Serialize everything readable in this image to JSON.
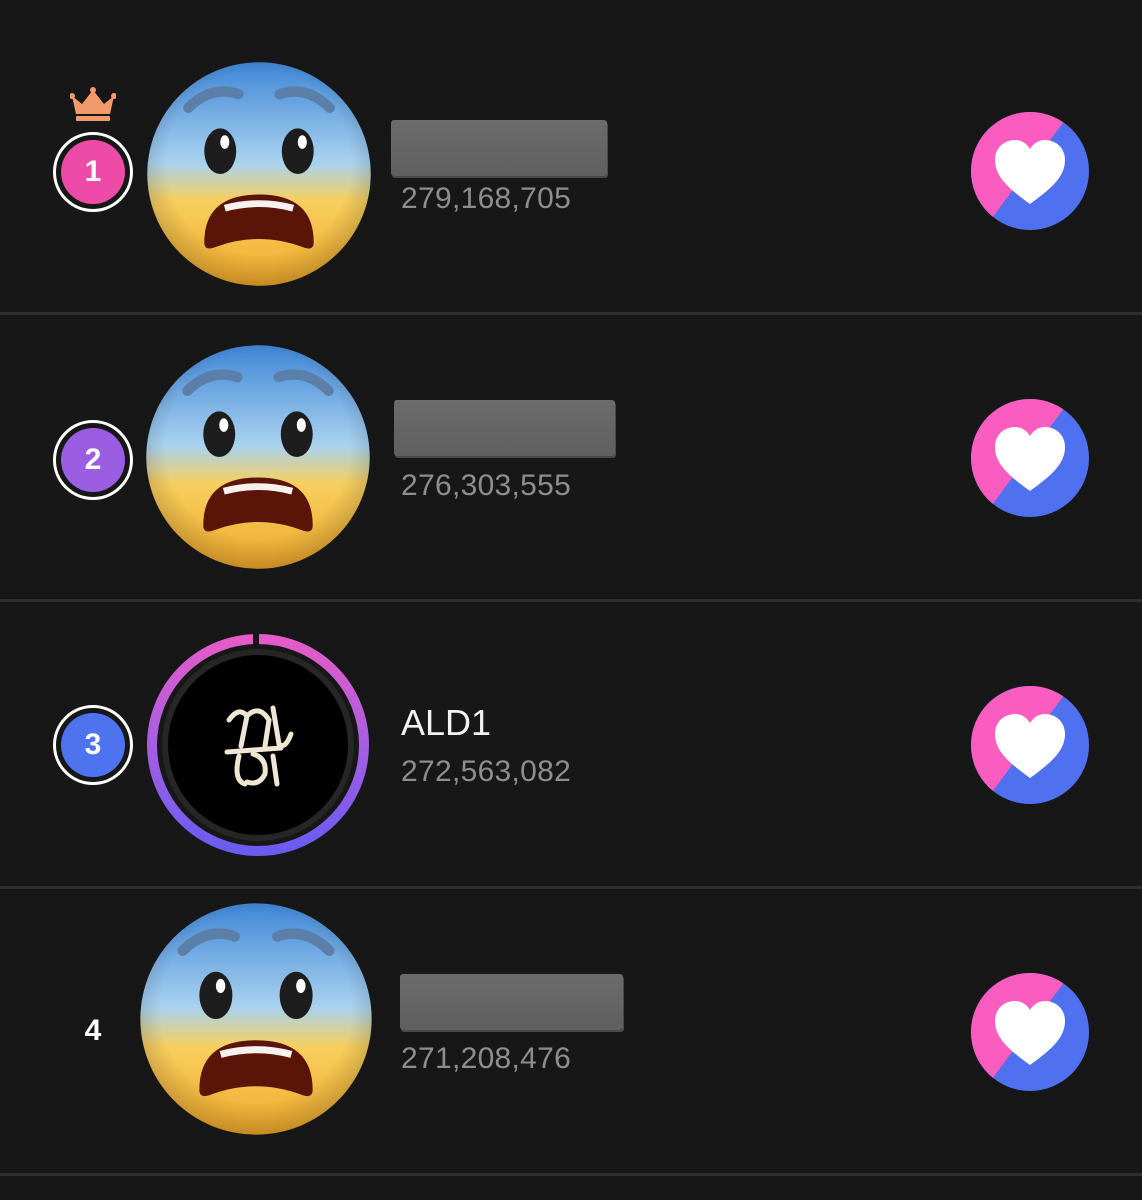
{
  "colors": {
    "background": "#171717",
    "divider": "#2f2f2f",
    "rank1": "#ee4ba8",
    "rank2": "#9b5de2",
    "rank3": "#4e73ee",
    "vote_pink": "#fb5cbf",
    "vote_blue": "#4f71f0",
    "vote_count": "#8e8e8e"
  },
  "ranking": [
    {
      "rank": "1",
      "name": "",
      "name_redacted": true,
      "votes": "279,168,705",
      "avatar_icon": "fearful-face-emoji",
      "crown": true
    },
    {
      "rank": "2",
      "name": "",
      "name_redacted": true,
      "votes": "276,303,555",
      "avatar_icon": "fearful-face-emoji",
      "crown": false
    },
    {
      "rank": "3",
      "name": "ALD1",
      "name_redacted": false,
      "votes": "272,563,082",
      "avatar_icon": "ald1-logo",
      "crown": false
    },
    {
      "rank": "4",
      "name": "",
      "name_redacted": true,
      "votes": "271,208,476",
      "avatar_icon": "fearful-face-emoji",
      "crown": false
    }
  ],
  "icons": {
    "crown": "crown-icon",
    "vote": "heart-vote-icon"
  }
}
